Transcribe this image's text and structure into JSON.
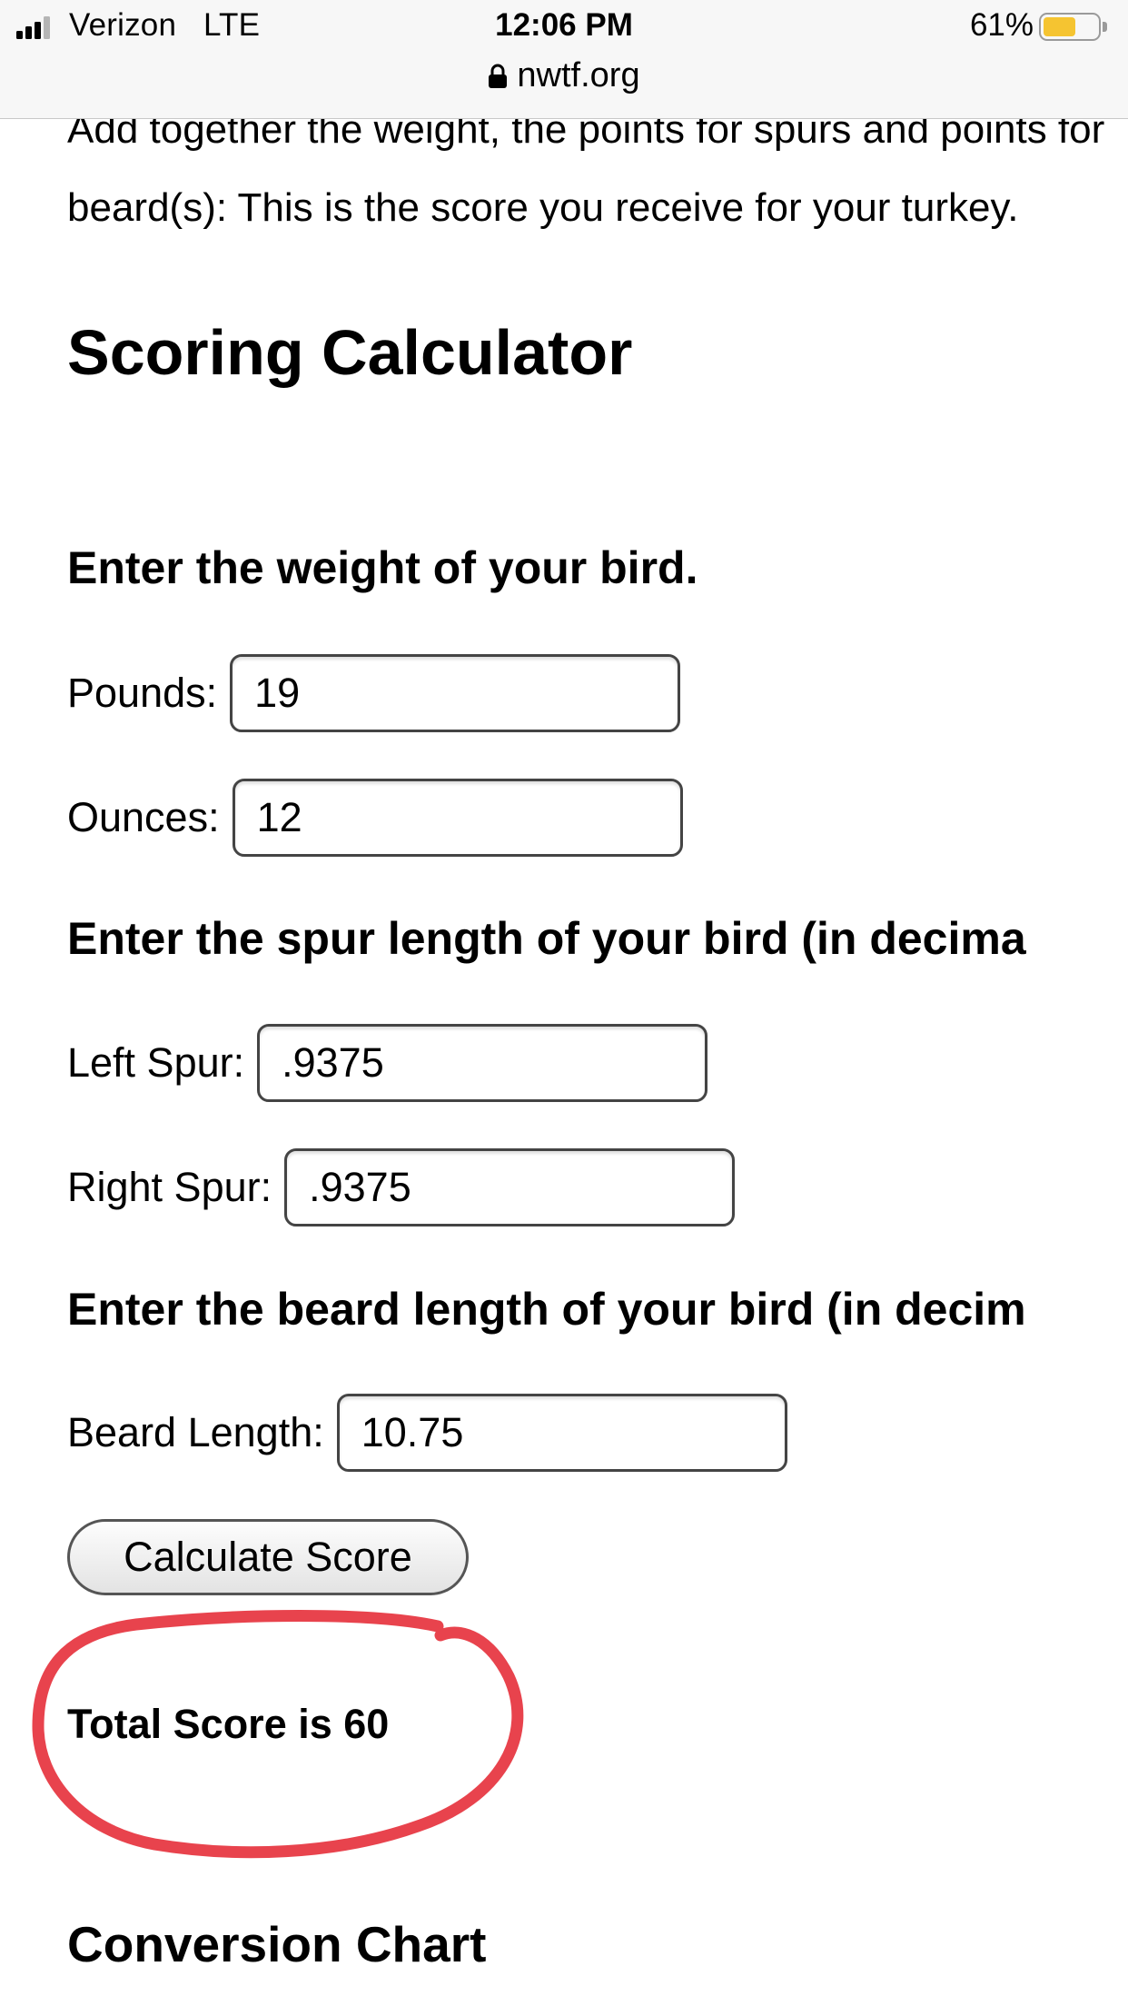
{
  "status_bar": {
    "carrier": "Verizon",
    "network": "LTE",
    "time": "12:06 PM",
    "battery_percent": "61%",
    "battery_level": 0.61,
    "battery_color": "#f5c431",
    "url": "nwtf.org"
  },
  "intro": {
    "text": "beard(s): This is the score you receive for your turkey.",
    "cut_line": "Add together the weight, the points for spurs and points for"
  },
  "calculator": {
    "title": "Scoring Calculator",
    "weight_heading": "Enter the weight of your bird.",
    "pounds_label": "Pounds:",
    "pounds_value": "19",
    "ounces_label": "Ounces:",
    "ounces_value": "12",
    "spur_heading": "Enter the spur length of your bird (in decima",
    "left_spur_label": "Left Spur:",
    "left_spur_value": ".9375",
    "right_spur_label": "Right Spur:",
    "right_spur_value": ".9375",
    "beard_heading": "Enter the beard length of your bird (in decim",
    "beard_label": "Beard Length:",
    "beard_value": "10.75",
    "button_label": "Calculate Score",
    "total_score": "Total Score is 60"
  },
  "annotation": {
    "circle_color": "#e8434d"
  },
  "conversion": {
    "title": "Conversion Chart"
  }
}
